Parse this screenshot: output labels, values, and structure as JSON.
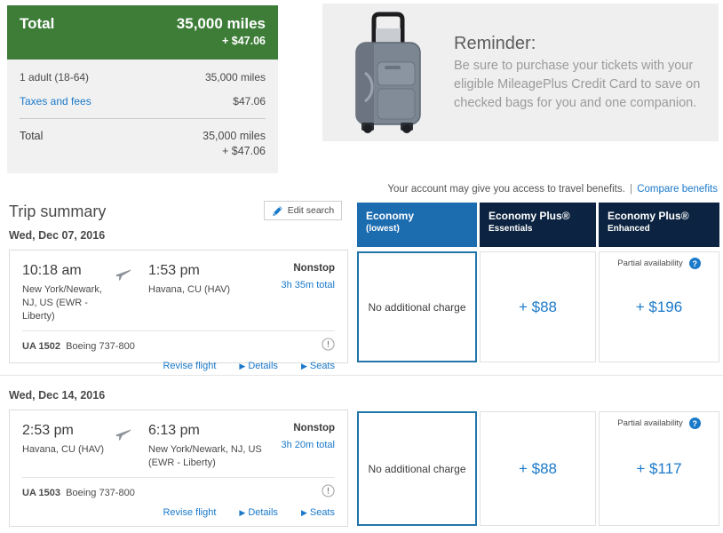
{
  "total_panel": {
    "header_label": "Total",
    "header_miles": "35,000 miles",
    "header_tax": "+ $47.06",
    "rows": [
      {
        "label": "1 adult (18-64)",
        "value": "35,000 miles",
        "is_link": false
      },
      {
        "label": "Taxes and fees",
        "value": "$47.06",
        "is_link": true
      }
    ],
    "final_label": "Total",
    "final_miles": "35,000 miles",
    "final_tax": "+ $47.06"
  },
  "reminder": {
    "title": "Reminder:",
    "body": "Be sure to purchase your tickets with your eligible MileagePlus Credit Card to save on checked bags for you and one companion.",
    "icon": "suitcase-icon"
  },
  "benefits_note": {
    "text": "Your account may give you access to travel benefits.",
    "separator": "|",
    "link": "Compare benefits"
  },
  "trip_summary": {
    "title": "Trip summary",
    "edit_button": "Edit search",
    "edit_icon": "pencil-icon"
  },
  "fare_columns": [
    {
      "title": "Economy",
      "subtitle": "(lowest)",
      "selected": true,
      "color": "#1c6cb0"
    },
    {
      "title": "Economy Plus®",
      "subtitle": "Essentials",
      "selected": false,
      "color": "#0c2441"
    },
    {
      "title": "Economy Plus®",
      "subtitle": "Enhanced",
      "selected": false,
      "color": "#0c2441"
    }
  ],
  "flights": [
    {
      "date": "Wed, Dec 07, 2016",
      "depart_time": "10:18 am",
      "depart_city": "New York/Newark, NJ, US (EWR - Liberty)",
      "arrive_time": "1:53 pm",
      "arrive_city": "Havana, CU (HAV)",
      "stops": "Nonstop",
      "duration": "3h 35m total",
      "flight_number": "UA 1502",
      "aircraft": "Boeing 737-800",
      "warning_icon": "exclamation-circle-icon",
      "links": {
        "revise": "Revise flight",
        "details": "Details",
        "seats": "Seats"
      },
      "fares": [
        {
          "label": "No additional charge",
          "selected": true,
          "availability": ""
        },
        {
          "label": "+ $88",
          "selected": false,
          "availability": ""
        },
        {
          "label": "+ $196",
          "selected": false,
          "availability": "Partial availability"
        }
      ]
    },
    {
      "date": "Wed, Dec 14, 2016",
      "depart_time": "2:53 pm",
      "depart_city": "Havana, CU (HAV)",
      "arrive_time": "6:13 pm",
      "arrive_city": "New York/Newark, NJ, US (EWR - Liberty)",
      "stops": "Nonstop",
      "duration": "3h 20m total",
      "flight_number": "UA 1503",
      "aircraft": "Boeing 737-800",
      "warning_icon": "exclamation-circle-icon",
      "links": {
        "revise": "Revise flight",
        "details": "Details",
        "seats": "Seats"
      },
      "fares": [
        {
          "label": "No additional charge",
          "selected": true,
          "availability": ""
        },
        {
          "label": "+ $88",
          "selected": false,
          "availability": ""
        },
        {
          "label": "+ $117",
          "selected": false,
          "availability": "Partial availability"
        }
      ]
    }
  ],
  "colors": {
    "green": "#3d7d38",
    "link_blue": "#1b79c9",
    "tab_blue": "#1c6cb0",
    "tab_navy": "#0c2441",
    "selected_border": "#2175a9"
  },
  "misc": {
    "help_glyph": "?",
    "caret_glyph": "▶"
  }
}
